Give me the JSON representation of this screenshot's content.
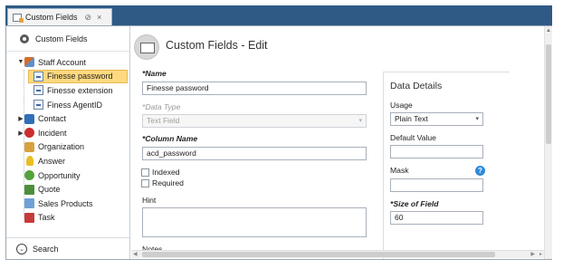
{
  "tab": {
    "label": "Custom Fields",
    "pin_glyph": "⊘",
    "close_glyph": "×"
  },
  "sidebar": {
    "header": "Custom Fields",
    "tree": [
      {
        "label": "Staff Account",
        "expanded": true,
        "icon": "people-icon"
      },
      {
        "label": "Finesse password",
        "selected": true,
        "icon": "field-icon"
      },
      {
        "label": "Finesse extension",
        "icon": "field-icon"
      },
      {
        "label": "Finess AgentID",
        "icon": "field-icon"
      },
      {
        "label": "Contact",
        "icon": "contact-icon"
      },
      {
        "label": "Incident",
        "icon": "incident-icon"
      },
      {
        "label": "Organization",
        "icon": "organization-icon"
      },
      {
        "label": "Answer",
        "icon": "answer-icon"
      },
      {
        "label": "Opportunity",
        "icon": "opportunity-icon"
      },
      {
        "label": "Quote",
        "icon": "quote-icon"
      },
      {
        "label": "Sales Products",
        "icon": "sales-products-icon"
      },
      {
        "label": "Task",
        "icon": "task-icon"
      }
    ],
    "search_label": "Search"
  },
  "main": {
    "title": "Custom Fields - Edit",
    "name": {
      "label": "*Name",
      "value": "Finesse password"
    },
    "data_type": {
      "label": "*Data Type",
      "value": "Text Field"
    },
    "column_name": {
      "label": "*Column Name",
      "value": "acd_password"
    },
    "indexed_label": "Indexed",
    "required_label": "Required",
    "hint_label": "Hint",
    "notes_label": "Notes"
  },
  "details": {
    "title": "Data Details",
    "usage": {
      "label": "Usage",
      "value": "Plain Text"
    },
    "default_value": {
      "label": "Default Value",
      "value": ""
    },
    "mask": {
      "label": "Mask",
      "value": ""
    },
    "size_of_field": {
      "label": "*Size of Field",
      "value": "60"
    }
  },
  "colors": {
    "tab_strip": "#2f5a86",
    "selected_row": "#ffd980",
    "help_icon": "#2e8ad8"
  }
}
